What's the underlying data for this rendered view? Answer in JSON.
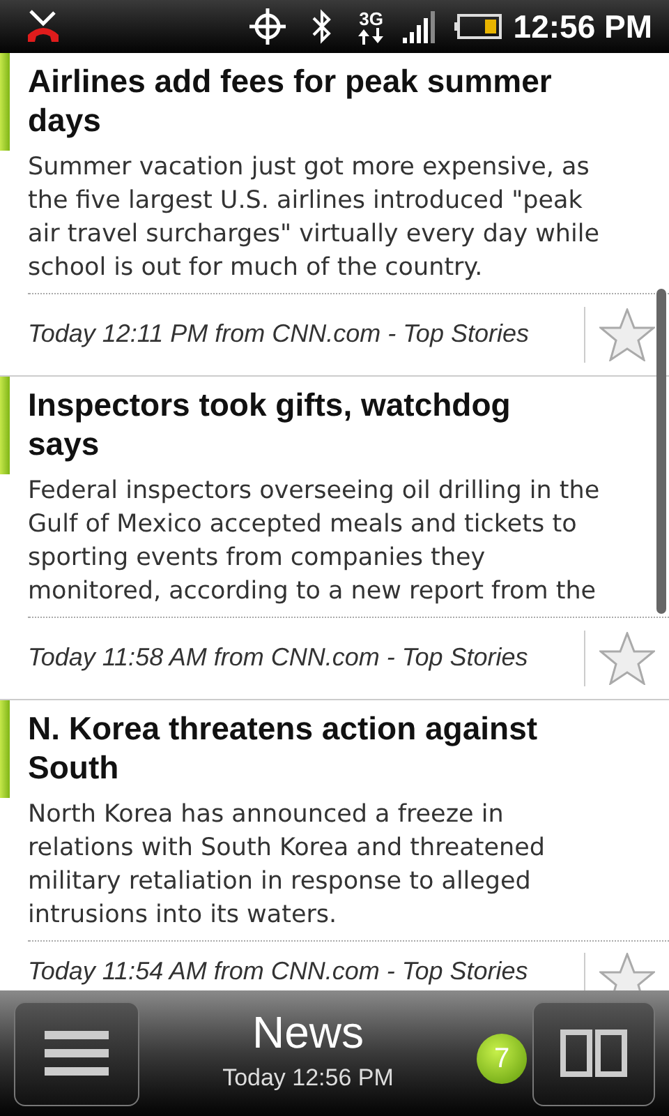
{
  "status_bar": {
    "time": "12:56 PM",
    "network": "3G"
  },
  "articles": [
    {
      "title": "Airlines add fees for peak summer days",
      "summary": "Summer vacation just got more expensive, as the five largest U.S. airlines introduced \"peak air travel surcharges\" virtually every day while school is out for much of the country.",
      "meta": "Today 12:11 PM from CNN.com - Top Stories"
    },
    {
      "title": "Inspectors took gifts, watchdog says",
      "summary": "Federal inspectors overseeing oil drilling in the Gulf of Mexico accepted meals and tickets to sporting events from companies they monitored, according to a new report from the",
      "meta": "Today 11:58 AM from CNN.com - Top Stories"
    },
    {
      "title": "N. Korea threatens action against South",
      "summary": "North Korea has announced a freeze in relations with South Korea and threatened military retaliation in response to alleged intrusions into its waters.",
      "meta": "Today 11:54 AM from CNN.com - Top Stories"
    }
  ],
  "bottom_bar": {
    "title": "News",
    "subtitle": "Today 12:56 PM",
    "badge": "7"
  }
}
